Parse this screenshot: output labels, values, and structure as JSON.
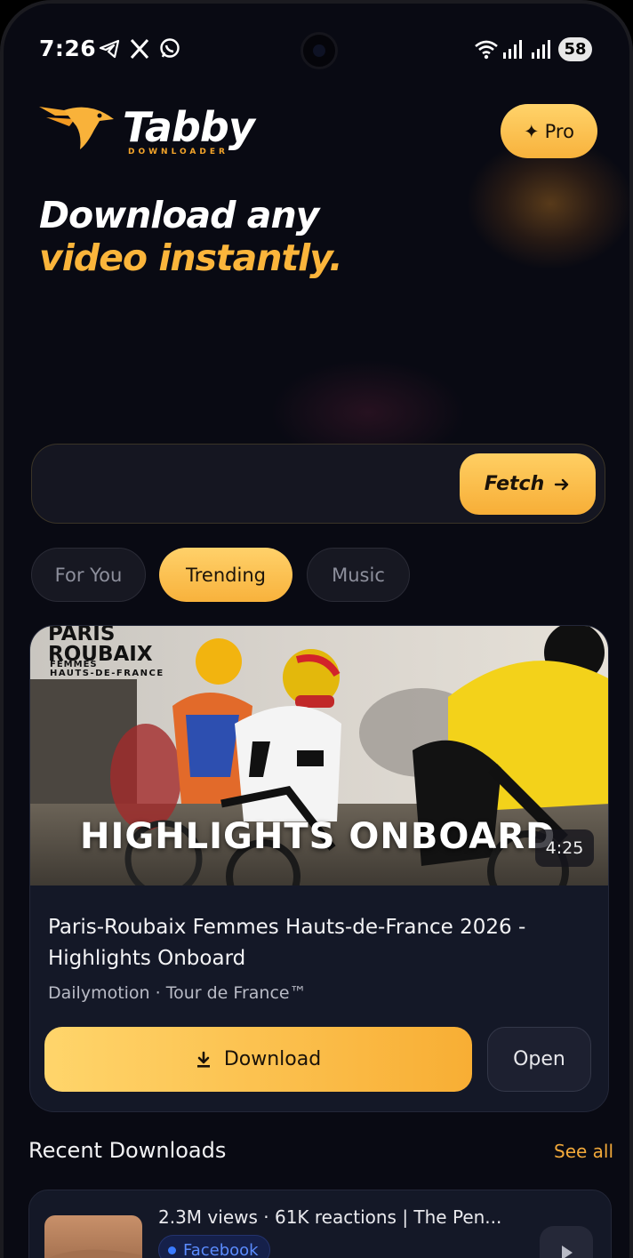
{
  "status_bar": {
    "time": "7:26",
    "battery": "58",
    "left_icons": [
      "telegram-icon",
      "x-icon",
      "whatsapp-icon"
    ],
    "right_icons": [
      "wifi-icon",
      "signal-icon",
      "signal-icon"
    ]
  },
  "header": {
    "logo_text": "Tabby",
    "logo_subtext": "DOWNLOADER",
    "pro_label": "Pro"
  },
  "hero": {
    "line1": "Download any",
    "line2": "video instantly."
  },
  "search": {
    "value": "",
    "placeholder": "",
    "fetch_label": "Fetch"
  },
  "tabs": [
    {
      "label": "For You",
      "active": false
    },
    {
      "label": "Trending",
      "active": true
    },
    {
      "label": "Music",
      "active": false
    }
  ],
  "featured": {
    "thumb_brand_line1": "PARIS",
    "thumb_brand_line2": "ROUBAIX",
    "thumb_brand_line3": "FEMMES",
    "thumb_brand_line4": "HAUTS-DE-FRANCE",
    "thumb_overlay": "HIGHLIGHTS ONBOARD",
    "duration": "4:25",
    "title": "Paris-Roubaix Femmes Hauts-de-France 2026 - Highlights Onboard",
    "meta": "Dailymotion · Tour de France™",
    "download_label": "Download",
    "open_label": "Open"
  },
  "recent": {
    "title": "Recent Downloads",
    "see_all": "See all",
    "items": [
      {
        "text": "2.3M views · 61K reactions | The Pen...",
        "source": "Facebook"
      }
    ]
  },
  "colors": {
    "accent": "#f8b23c",
    "background": "#090a13",
    "card": "#141827",
    "facebook_blue": "#3a7bff"
  }
}
